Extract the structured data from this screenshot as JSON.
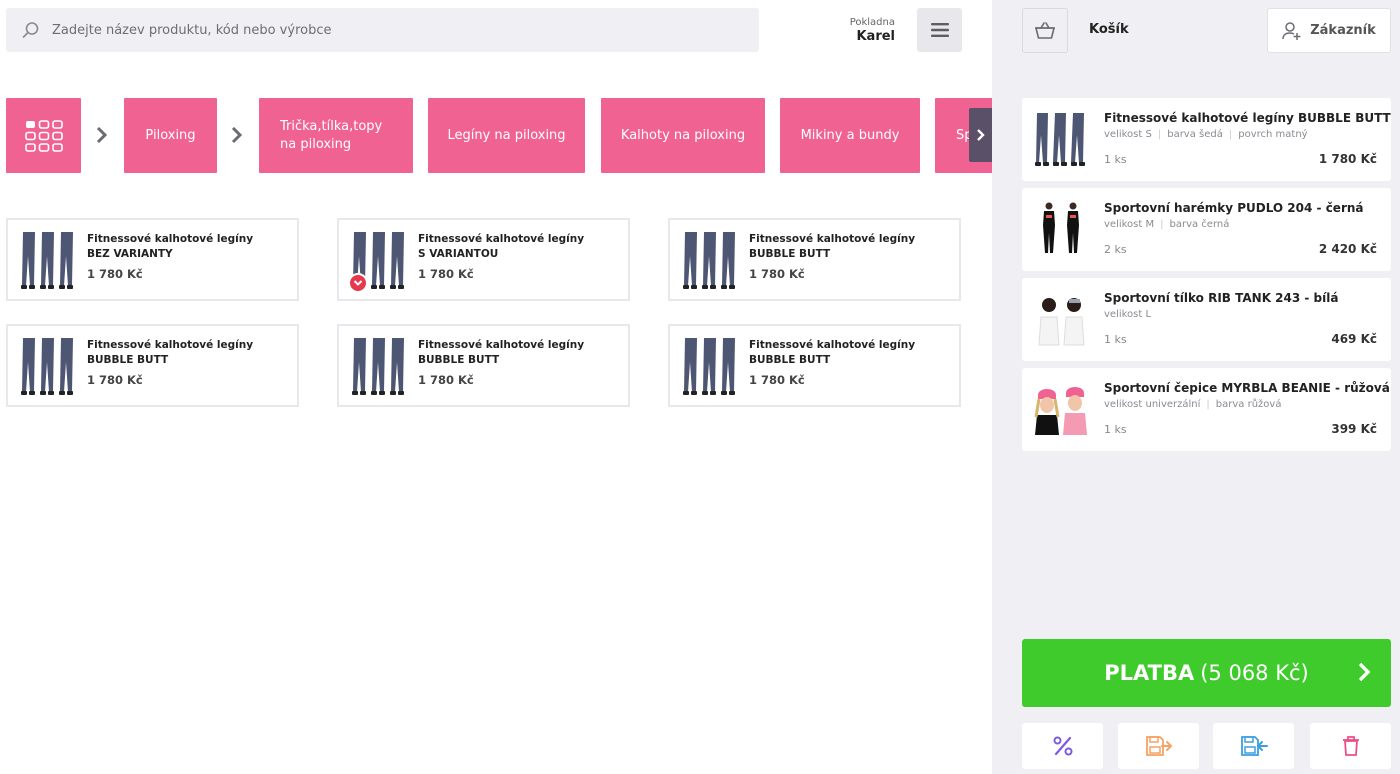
{
  "search": {
    "placeholder": "Zadejte název produktu, kód nebo výrobce"
  },
  "cashier": {
    "label": "Pokladna",
    "name": "Karel"
  },
  "categories": [
    {
      "label": "Piloxing"
    },
    {
      "label": "Trička,tílka,topy na piloxing"
    },
    {
      "label": "Legíny na piloxing"
    },
    {
      "label": "Kalhoty na piloxing"
    },
    {
      "label": "Mikiny a bundy"
    },
    {
      "label": "Sp"
    }
  ],
  "products": [
    {
      "name_line1": "Fitnessové kalhotové legíny",
      "name_line2": "BEZ VARIANTY",
      "price": "1 780 Kč"
    },
    {
      "name_line1": "Fitnessové kalhotové legíny",
      "name_line2": "S VARIANTOU",
      "price": "1 780 Kč"
    },
    {
      "name_line1": "Fitnessové kalhotové legíny",
      "name_line2": "BUBBLE BUTT",
      "price": "1 780 Kč"
    },
    {
      "name_line1": "Fitnessové kalhotové legíny",
      "name_line2": "BUBBLE BUTT",
      "price": "1 780 Kč"
    },
    {
      "name_line1": "Fitnessové kalhotové legíny",
      "name_line2": "BUBBLE BUTT",
      "price": "1 780 Kč"
    },
    {
      "name_line1": "Fitnessové kalhotové legíny",
      "name_line2": "BUBBLE BUTT",
      "price": "1 780 Kč"
    }
  ],
  "cart": {
    "title": "Košík",
    "customer_label": "Zákazník",
    "items": [
      {
        "name": "Fitnessové kalhotové legíny BUBBLE BUTT",
        "attrs": [
          "velikost S",
          "barva šedá",
          "povrch matný"
        ],
        "qty": "1 ks",
        "price": "1 780 Kč"
      },
      {
        "name": "Sportovní harémky PUDLO 204 - černá",
        "attrs": [
          "velikost M",
          "barva černá"
        ],
        "qty": "2 ks",
        "price": "2 420 Kč"
      },
      {
        "name": "Sportovní tílko RIB TANK 243 - bílá",
        "attrs": [
          "velikost L"
        ],
        "qty": "1 ks",
        "price": "469 Kč"
      },
      {
        "name": "Sportovní čepice MYRBLA BEANIE - růžová",
        "attrs": [
          "velikost univerzální",
          "barva růžová"
        ],
        "qty": "1 ks",
        "price": "399 Kč"
      }
    ],
    "pay_label": "PLATBA",
    "pay_total": "(5 068 Kč)"
  },
  "colors": {
    "category_pink": "#f06292",
    "pay_green": "#3fcb2c",
    "sidebar_bg": "#efeff4",
    "badge_red": "#e53950"
  },
  "icons": {
    "search": "search-icon",
    "menu": "hamburger-menu-icon",
    "home": "grid-icon",
    "basket": "basket-icon",
    "customer": "add-user-icon",
    "discount": "percent-icon",
    "park": "save-out-icon",
    "restore": "save-in-icon",
    "delete": "trash-icon"
  }
}
